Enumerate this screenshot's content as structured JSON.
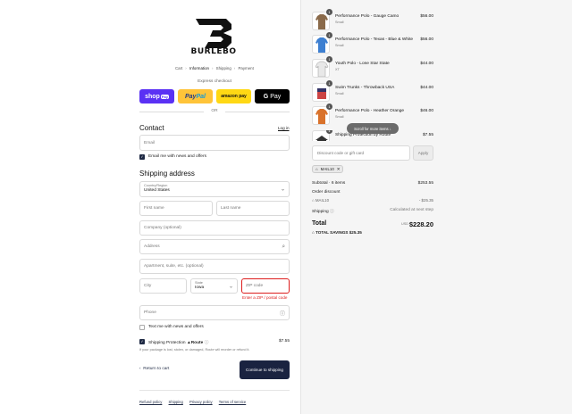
{
  "brand": {
    "name": "BURLEBO"
  },
  "breadcrumb": [
    "Cart",
    "Information",
    "Shipping",
    "Payment"
  ],
  "express": {
    "label": "Express checkout",
    "shoppay": "shop",
    "shoppay_pill": "Pay",
    "paypal_a": "Pay",
    "paypal_b": "Pal",
    "amazon": "amazon pay",
    "gpay_g": "G",
    "gpay": "Pay",
    "or": "OR"
  },
  "contact": {
    "heading": "Contact",
    "login": "Log in",
    "email_placeholder": "Email",
    "email_news": "Email me with news and offers"
  },
  "shipping": {
    "heading": "Shipping address",
    "country_label": "Country/Region",
    "country_value": "United States",
    "first_name": "First name",
    "last_name": "Last name",
    "company": "Company (optional)",
    "address": "Address",
    "apartment": "Apartment, suite, etc. (optional)",
    "city": "City",
    "state_label": "State",
    "state_value": "Iowa",
    "zip": "ZIP code",
    "zip_error": "Enter a ZIP / postal code",
    "phone": "Phone",
    "text_news": "Text me with news and offers",
    "protection_label": "Shipping Protection",
    "protection_brand": "Route",
    "protection_price": "$7.55",
    "protection_note": "If your package is lost, stolen, or damaged, Route will reorder or refund it."
  },
  "actions": {
    "return": "Return to cart",
    "continue": "Continue to shipping"
  },
  "footer": [
    "Refund policy",
    "Shipping",
    "Privacy policy",
    "Terms of service"
  ],
  "order": {
    "items": [
      {
        "qty": "1",
        "name": "Performance Polo - Gauge Camo",
        "variant": "Small",
        "price": "$56.00"
      },
      {
        "qty": "1",
        "name": "Performance Polo - Texas - Blue & White",
        "variant": "Small",
        "price": "$56.00"
      },
      {
        "qty": "1",
        "name": "Youth Polo - Lone Star State",
        "variant": "XT",
        "price": "$44.00"
      },
      {
        "qty": "1",
        "name": "Swim Trunks - Throwback USA",
        "variant": "Small",
        "price": "$44.00"
      },
      {
        "qty": "1",
        "name": "Performance Polo - Heather Orange",
        "variant": "Small",
        "price": "$46.00"
      },
      {
        "qty": "1",
        "name": "Shipping Protection by Route",
        "variant": "",
        "price": "$7.55"
      }
    ],
    "scroll_hint": "Scroll for more items",
    "discount_placeholder": "Discount code or gift card",
    "apply": "Apply",
    "code_tag": "MAIL10",
    "subtotal_label": "Subtotal · 6 items",
    "subtotal_value": "$253.55",
    "order_discount_label": "Order discount",
    "discount_code": "MAIL10",
    "discount_value": "- $25.35",
    "shipping_label": "Shipping",
    "shipping_value": "Calculated at next step",
    "total_label": "Total",
    "currency": "USD",
    "total_value": "$228.20",
    "savings": "TOTAL SAVINGS  $25.35"
  },
  "colors": {
    "primary_button": "#1a2340",
    "error": "#dd1d1d",
    "shoppay": "#5a31f4",
    "paypal": "#ffc439",
    "amazon": "#ffd814"
  }
}
